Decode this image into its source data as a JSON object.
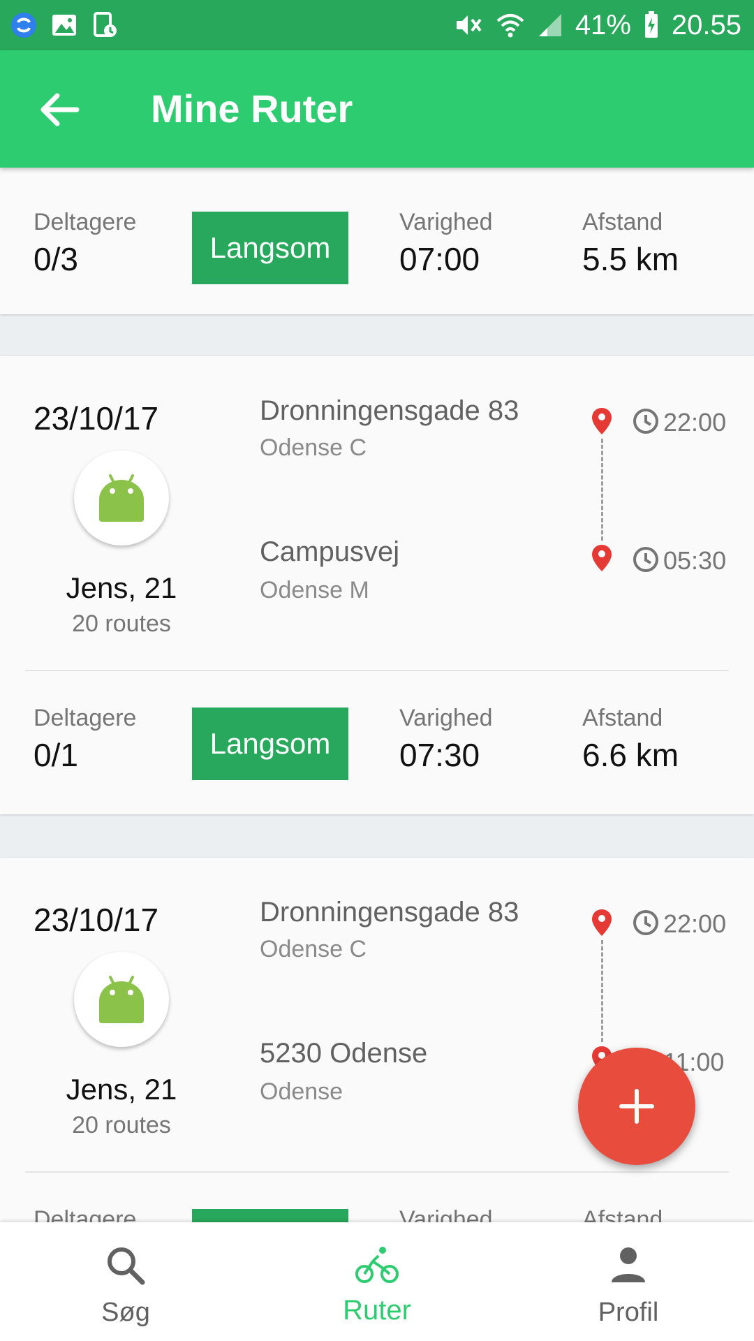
{
  "status_bar": {
    "battery": "41%",
    "time": "20.55",
    "icons": [
      "sync-icon",
      "gallery-icon",
      "screenshot-icon",
      "vibrate-mute-icon",
      "wifi-icon",
      "signal-icon",
      "battery-charging-icon"
    ]
  },
  "toolbar": {
    "title": "Mine Ruter",
    "back_icon": "arrow-left-icon"
  },
  "colors": {
    "status_bar": "#27a85a",
    "toolbar": "#2ecc71",
    "badge": "#28a85c",
    "fab": "#e84c3d",
    "pin": "#e53935",
    "active_nav": "#2ecc71"
  },
  "labels": {
    "participants": "Deltagere",
    "duration": "Varighed",
    "distance": "Afstand"
  },
  "partial_top_card": {
    "participants": "0/3",
    "speed": "Langsom",
    "duration": "07:00",
    "distance": "5.5 km"
  },
  "routes": [
    {
      "date": "23/10/17",
      "user_name": "Jens, 21",
      "user_routes": "20 routes",
      "from_name": "Dronningensgade 83",
      "from_city": "Odense C",
      "from_time": "22:00",
      "to_name": "Campusvej",
      "to_city": "Odense M",
      "to_time": "05:30",
      "participants": "0/1",
      "speed": "Langsom",
      "duration": "07:30",
      "distance": "6.6 km"
    },
    {
      "date": "23/10/17",
      "user_name": "Jens, 21",
      "user_routes": "20 routes",
      "from_name": "Dronningensgade 83",
      "from_city": "Odense C",
      "from_time": "22:00",
      "to_name": "5230 Odense",
      "to_city": "Odense",
      "to_time": "11:00"
    }
  ],
  "fab": {
    "icon": "plus-icon"
  },
  "bottom_nav": [
    {
      "label": "Søg",
      "icon": "search-icon",
      "active": false
    },
    {
      "label": "Ruter",
      "icon": "bicycle-icon",
      "active": true
    },
    {
      "label": "Profil",
      "icon": "person-icon",
      "active": false
    }
  ]
}
